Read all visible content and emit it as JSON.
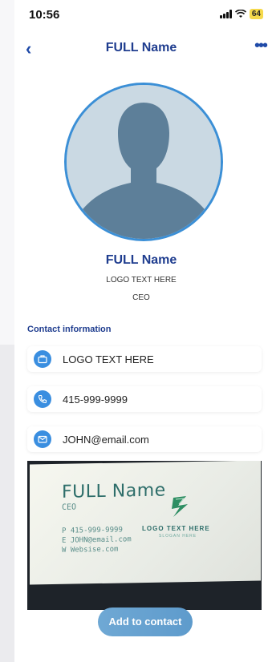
{
  "status_bar": {
    "time": "10:56",
    "battery": "64"
  },
  "nav": {
    "back_icon": "chevron-left-icon",
    "title": "FULL Name",
    "more_icon": "more-horizontal-icon"
  },
  "profile": {
    "name": "FULL Name",
    "company": "LOGO TEXT HERE",
    "role": "CEO"
  },
  "contact": {
    "section_title": "Contact information",
    "items": [
      {
        "icon": "briefcase-icon",
        "text": "LOGO TEXT HERE"
      },
      {
        "icon": "phone-icon",
        "text": "415-999-9999"
      },
      {
        "icon": "mail-icon",
        "text": "JOHN@email.com"
      }
    ]
  },
  "business_card": {
    "name": "FULL Name",
    "role": "CEO",
    "phone": "P  415-999-9999",
    "email": "E  JOHN@email.com",
    "website": "W  Websise.com",
    "logo_text": "LOGO TEXT HERE",
    "slogan": "SLOGAN HERE"
  },
  "actions": {
    "add_to_contact": "Add to contact"
  },
  "colors": {
    "primary": "#1f3d8f",
    "accent": "#3a8ee0",
    "battery": "#f5d94b"
  }
}
